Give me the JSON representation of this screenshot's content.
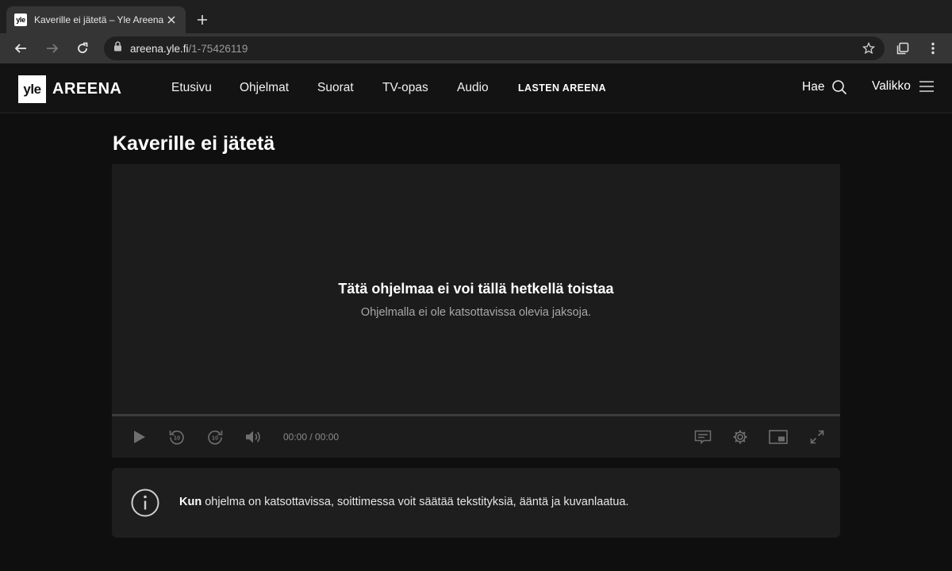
{
  "browser": {
    "tab_favicon": "yle",
    "tab_title": "Kaverille ei jätetä – Yle Areena",
    "url_host": "areena.yle.fi",
    "url_path": "/1-75426119",
    "icons": [
      "close-icon",
      "plus-icon",
      "back-arrow-icon",
      "forward-arrow-icon",
      "reload-icon",
      "lock-icon",
      "star-icon",
      "tab-search-icon",
      "kebab-menu-icon"
    ]
  },
  "header": {
    "logo_mark": "yle",
    "logo_text": "AREENA",
    "nav": [
      "Etusivu",
      "Ohjelmat",
      "Suorat",
      "TV-opas",
      "Audio"
    ],
    "lasten": "LASTEN AREENA",
    "search_label": "Hae",
    "menu_label": "Valikko"
  },
  "main": {
    "title": "Kaverille ei jätetä",
    "player": {
      "message_title": "Tätä ohjelmaa ei voi tällä hetkellä toistaa",
      "message_sub": "Ohjelmalla ei ole katsottavissa olevia jaksoja.",
      "time": "00:00 / 00:00",
      "progress": 0
    },
    "info": {
      "bold": "Kun",
      "text": " ohjelma on katsottavissa, soittimessa voit säätää tekstityksiä, ääntä ja kuvanlaatua."
    }
  },
  "colors": {
    "page_bg": "#0f0f0f",
    "player_bg": "#1c1c1c",
    "control_icon": "#6e6e6e"
  }
}
